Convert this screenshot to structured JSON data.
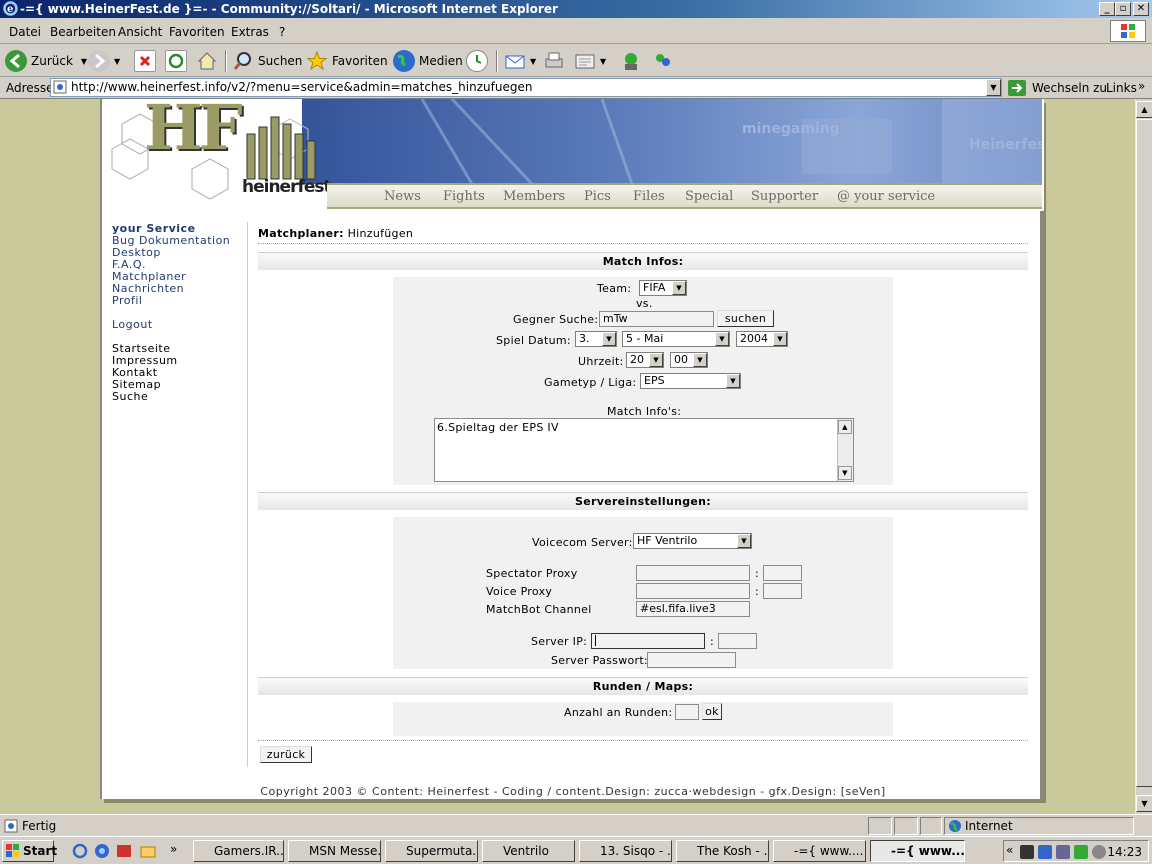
{
  "window": {
    "title": "-={ www.HeinerFest.de }=- - Community://Soltari/ - Microsoft Internet Explorer"
  },
  "menubar": {
    "items": [
      "Datei",
      "Bearbeiten",
      "Ansicht",
      "Favoriten",
      "Extras",
      "?"
    ]
  },
  "toolbar": {
    "back_label": "Zurück",
    "search_label": "Suchen",
    "favorites_label": "Favoriten",
    "media_label": "Medien"
  },
  "addressbar": {
    "label": "Adresse",
    "url": "http://www.heinerfest.info/v2/?menu=service&admin=matches_hinzufuegen",
    "go_label": "Wechseln zu",
    "links_label": "Links"
  },
  "site": {
    "logo_text": "HF",
    "logo_sub": "heinerfest",
    "banner_text_1": "minegaming",
    "banner_text_2": "Heinerfest",
    "nav": [
      "News",
      "Fights",
      "Members",
      "Pics",
      "Files",
      "Special",
      "Supporter",
      "@ your service"
    ]
  },
  "sidebar": {
    "section1": [
      "your Service",
      "Bug Dokumentation",
      "Desktop",
      "F.A.Q.",
      "Matchplaner",
      "Nachrichten",
      "Profil"
    ],
    "logout": "Logout",
    "section2": [
      "Startseite",
      "Impressum",
      "Kontakt",
      "Sitemap",
      "Suche"
    ]
  },
  "content": {
    "title_bold": "Matchplaner:",
    "title_rest": "Hinzufügen",
    "match_infos": {
      "heading": "Match Infos:",
      "team_label": "Team:",
      "team_value": "FIFA",
      "vs": "vs.",
      "opponent_label": "Gegner Suche:",
      "opponent_value": "mTw",
      "search_button": "suchen",
      "date_label": "Spiel Datum:",
      "day": "3.",
      "month": "5 - Mai",
      "year": "2004",
      "time_label": "Uhrzeit:",
      "hour": "20",
      "minute": "00",
      "gametype_label": "Gametyp / Liga:",
      "gametype_value": "EPS",
      "info_label": "Match Info's:",
      "info_value": "6.Spieltag der EPS IV"
    },
    "server": {
      "heading": "Servereinstellungen:",
      "voicecom_label": "Voicecom Server:",
      "voicecom_value": "HF Ventrilo",
      "spectator_label": "Spectator Proxy",
      "voice_label": "Voice Proxy",
      "matchbot_label": "MatchBot Channel",
      "matchbot_value": "#esl.fifa.live3",
      "colon": ":",
      "ip_label": "Server IP:",
      "password_label": "Server Passwort:"
    },
    "rounds": {
      "heading": "Runden / Maps:",
      "count_label": "Anzahl an Runden:",
      "ok_button": "ok"
    },
    "back_button": "zurück",
    "footer": "Copyright 2003 © Content: Heinerfest - Coding / content.Design: zucca·webdesign - gfx.Design: [seVen]"
  },
  "statusbar": {
    "status": "Fertig",
    "zone": "Internet"
  },
  "taskbar": {
    "start": "Start",
    "tasks": [
      "Gamers.IR...",
      "MSN Messe...",
      "Supermuta...",
      "Ventrilo",
      "13. Sisqo - ...",
      "The Kosh - ...",
      "-={ www....",
      "-={ www...."
    ],
    "clock": "14:23"
  }
}
